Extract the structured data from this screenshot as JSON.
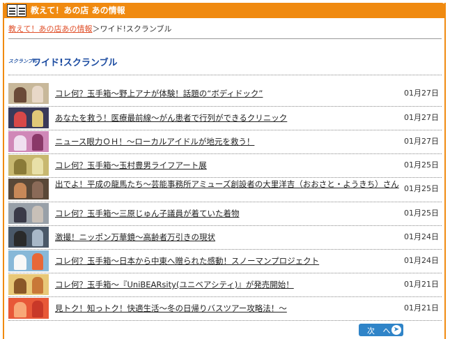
{
  "header": {
    "title": "教えて！あの店 あの情報"
  },
  "breadcrumb": {
    "link": "教えて！あの店あの情報",
    "separator": "＞",
    "current": "ワイド!スクランブル"
  },
  "section": {
    "logo_text": "スクランブル",
    "title": "ワイド!スクランブル"
  },
  "items": [
    {
      "title": "コレ何？玉手箱〜野上アナが体験！話題の“ボディドック”",
      "date": "01月27日"
    },
    {
      "title": "あなたを救う！医療最前線〜がん患者で行列ができるクリニック",
      "date": "01月27日"
    },
    {
      "title": "ニュース眼力ＯＨ！〜ローカルアイドルが地元を救う！",
      "date": "01月27日"
    },
    {
      "title": "コレ何？玉手箱〜玉村豊男ライフアート展",
      "date": "01月25日"
    },
    {
      "title": "出でよ！平成の龍馬たち〜芸能事務所アミューズ創設者の大里洋吉（おおさと・ようきち）さん",
      "date": "01月25日"
    },
    {
      "title": "コレ何？玉手箱〜三原じゅん子議員が着ていた着物",
      "date": "01月25日"
    },
    {
      "title": "激撮！ニッポン万華鏡〜高齢者万引きの現状",
      "date": "01月24日"
    },
    {
      "title": "コレ何？玉手箱〜日本から中東へ贈られた感動！スノーマンプロジェクト",
      "date": "01月24日"
    },
    {
      "title": "コレ何？玉手箱〜『UniBEARsity(ユニベアシティ)』が発売開始！",
      "date": "01月21日"
    },
    {
      "title": "見トク！知っトク！快適生活〜冬の日帰りバスツアー攻略法！〜",
      "date": "01月21日"
    }
  ],
  "pager": {
    "next_label": "次 へ",
    "next_icon": "arrow-right-circle-icon"
  },
  "colors": {
    "accent": "#f08a10",
    "link": "#e0502a",
    "button": "#2f84c8",
    "title": "#1a4aa0"
  }
}
